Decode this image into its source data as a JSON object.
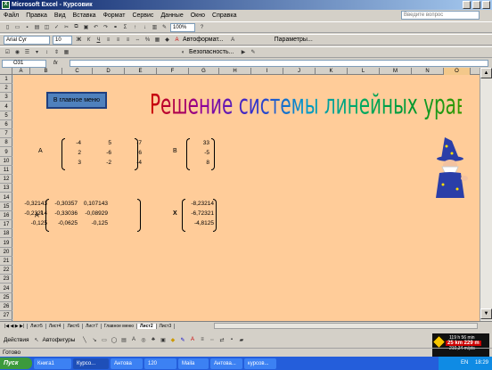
{
  "window": {
    "title": "Microsoft Excel - Курсовик"
  },
  "menu": [
    "Файл",
    "Правка",
    "Вид",
    "Вставка",
    "Формат",
    "Сервис",
    "Данные",
    "Окно",
    "Справка"
  ],
  "ask_placeholder": "Введите вопрос",
  "toolbar": {
    "zoom": "100%",
    "font": "Arial Cyr",
    "size": "10",
    "autoformat": "Автоформат...",
    "params": "Параметры...",
    "security": "Безопасность..."
  },
  "formula": {
    "namebox": "O31",
    "fx": "fx"
  },
  "columns": [
    "A",
    "B",
    "C",
    "D",
    "E",
    "F",
    "G",
    "H",
    "I",
    "J",
    "K",
    "L",
    "M",
    "N",
    "O"
  ],
  "rows": [
    "1",
    "2",
    "3",
    "4",
    "5",
    "6",
    "7",
    "8",
    "9",
    "10",
    "11",
    "12",
    "13",
    "14",
    "15",
    "16",
    "17",
    "18",
    "19",
    "20",
    "21",
    "22",
    "23",
    "24",
    "25",
    "26",
    "27"
  ],
  "sheet": {
    "main_menu_button": "В главное меню",
    "heading": "Решение системы линейных уравнений",
    "label_a": "A",
    "label_b": "B",
    "label_ainv": "A",
    "label_ainv_sup": "-1",
    "label_x": "X",
    "matrix_a": [
      [
        "-4",
        "5",
        "-7"
      ],
      [
        "2",
        "-6",
        "6"
      ],
      [
        "3",
        "-2",
        "-4"
      ]
    ],
    "vector_b": [
      "33",
      "-5",
      "8"
    ],
    "matrix_ainv": [
      [
        "-0,32143",
        "-0,30357",
        "0,107143"
      ],
      [
        "-0,23214",
        "-0,33036",
        "-0,08929"
      ],
      [
        "-0,125",
        "-0,0625",
        "-0,125"
      ]
    ],
    "vector_x": [
      "-8,23214",
      "-6,72321",
      "-4,8125"
    ]
  },
  "tabs": [
    "Лист5",
    "Лист4",
    "Лист6",
    "Лист7",
    "Главное меню",
    "Лист2",
    "Лист3"
  ],
  "active_tab": "Лист2",
  "draw": {
    "actions": "Действия",
    "autoshapes": "Автофигуры"
  },
  "status": "Готово",
  "gps": {
    "eta": "119 h 56 min",
    "dist": "25 km 229 m",
    "dist2": "210,34 m/pts"
  },
  "taskbar": {
    "start": "Пуск",
    "tasks": [
      "Книга1",
      "Курсо...",
      "Антова",
      "120",
      "Maila",
      "Антова...",
      "курсов..."
    ],
    "time": "18:29",
    "lang": "EN"
  }
}
